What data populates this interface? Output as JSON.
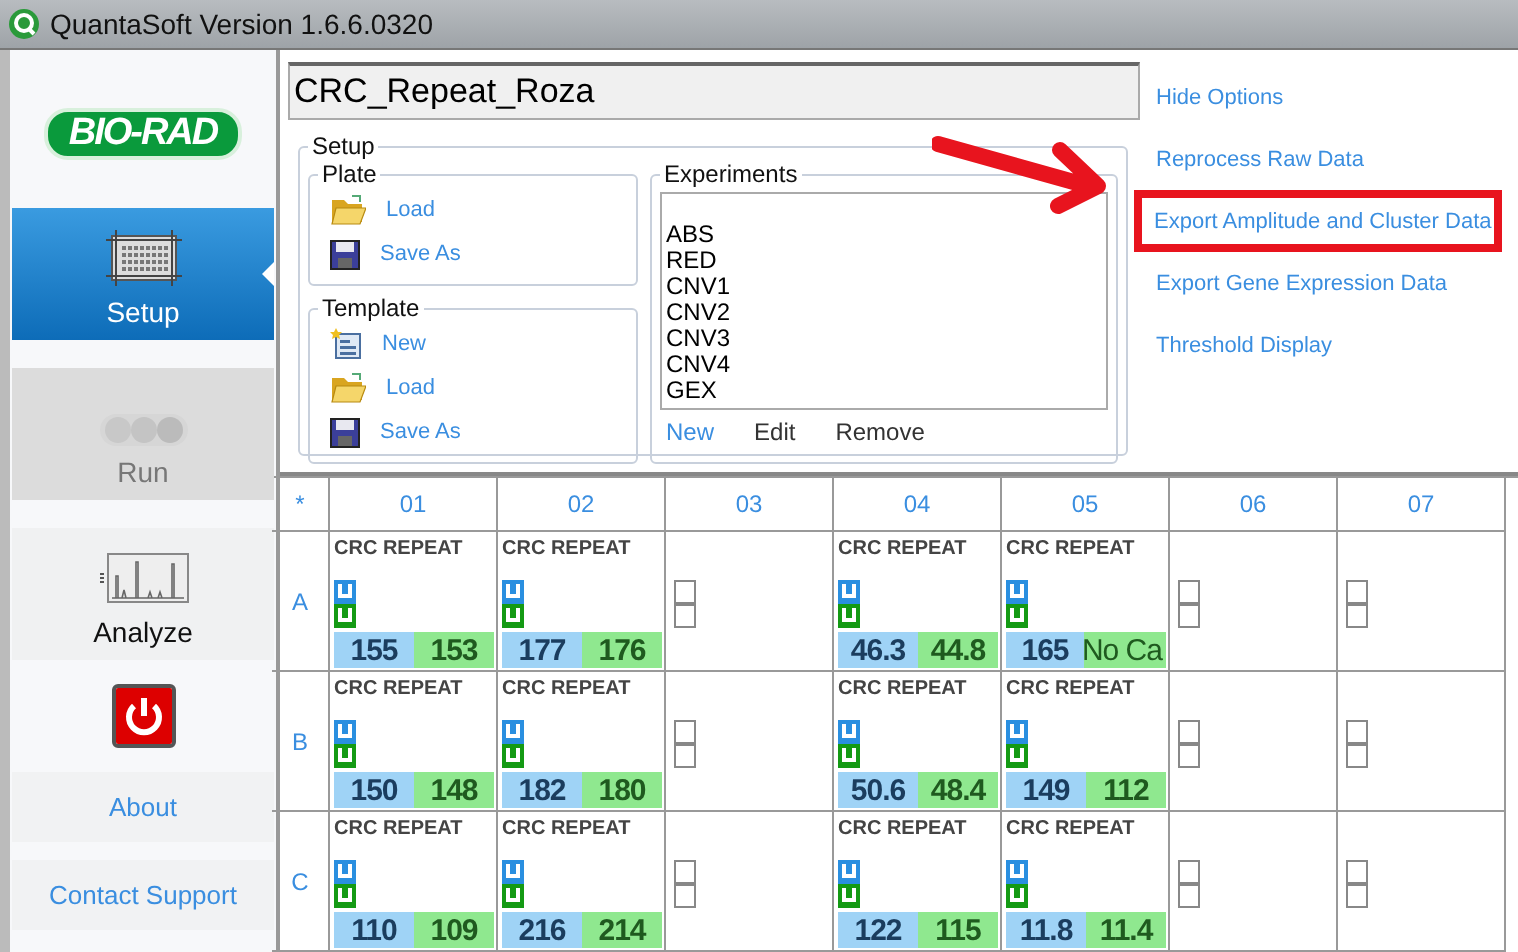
{
  "window": {
    "title": "QuantaSoft Version 1.6.6.0320"
  },
  "sidebar": {
    "logo": "BIO-RAD",
    "nav": [
      {
        "label": "Setup",
        "selected": true,
        "disabled": false
      },
      {
        "label": "Run",
        "selected": false,
        "disabled": true
      },
      {
        "label": "Analyze",
        "selected": false,
        "disabled": false
      }
    ],
    "links": [
      "About",
      "Contact Support"
    ]
  },
  "plate_name": "CRC_Repeat_Roza",
  "setup": {
    "title": "Setup",
    "groups": [
      {
        "title": "Plate",
        "actions": [
          {
            "kind": "load",
            "label": "Load"
          },
          {
            "kind": "save",
            "label": "Save As"
          }
        ]
      },
      {
        "title": "Template",
        "actions": [
          {
            "kind": "new",
            "label": "New"
          },
          {
            "kind": "load",
            "label": "Load"
          },
          {
            "kind": "save",
            "label": "Save As"
          }
        ]
      }
    ],
    "experiments": {
      "title": "Experiments",
      "items": [
        "ABS",
        "RED",
        "CNV1",
        "CNV2",
        "CNV3",
        "CNV4",
        "GEX"
      ],
      "actions": [
        {
          "label": "New",
          "disabled": false
        },
        {
          "label": "Edit",
          "disabled": true
        },
        {
          "label": "Remove",
          "disabled": true
        }
      ]
    }
  },
  "options": [
    {
      "label": "Hide Options",
      "highlighted": false
    },
    {
      "label": "Reprocess Raw Data",
      "highlighted": false
    },
    {
      "label": "Export Amplitude and Cluster Data",
      "highlighted": true
    },
    {
      "label": "Export Gene Expression Data",
      "highlighted": false
    },
    {
      "label": "Threshold Display",
      "highlighted": false
    }
  ],
  "plate": {
    "corner": "*",
    "columns": [
      "01",
      "02",
      "03",
      "04",
      "05",
      "06",
      "07"
    ],
    "rows": [
      {
        "label": "A",
        "wells": [
          {
            "kind": "sample",
            "name": "CRC REPEAT",
            "ch1": "155",
            "ch2": "153"
          },
          {
            "kind": "sample",
            "name": "CRC REPEAT",
            "ch1": "177",
            "ch2": "176"
          },
          {
            "kind": "empty",
            "checks": [
              {
                "checked": false
              },
              {
                "checked": false
              }
            ]
          },
          {
            "kind": "sample",
            "name": "CRC REPEAT",
            "ch1": "46.3",
            "ch2": "44.8"
          },
          {
            "kind": "sample",
            "name": "CRC REPEAT",
            "ch1": "165",
            "ch2": "No Ca"
          },
          {
            "kind": "empty",
            "checks": [
              {
                "checked": false
              },
              {
                "checked": false
              }
            ]
          },
          {
            "kind": "empty",
            "checks": [
              {
                "checked": false
              },
              {
                "checked": false
              }
            ]
          }
        ]
      },
      {
        "label": "B",
        "wells": [
          {
            "kind": "sample",
            "name": "CRC REPEAT",
            "ch1": "150",
            "ch2": "148"
          },
          {
            "kind": "sample",
            "name": "CRC REPEAT",
            "ch1": "182",
            "ch2": "180"
          },
          {
            "kind": "empty",
            "checks": [
              {
                "checked": false
              },
              {
                "checked": false
              }
            ]
          },
          {
            "kind": "sample",
            "name": "CRC REPEAT",
            "ch1": "50.6",
            "ch2": "48.4"
          },
          {
            "kind": "sample",
            "name": "CRC REPEAT",
            "ch1": "149",
            "ch2": "112"
          },
          {
            "kind": "empty",
            "checks": [
              {
                "checked": false
              },
              {
                "checked": false
              }
            ]
          },
          {
            "kind": "empty",
            "checks": [
              {
                "checked": false
              },
              {
                "checked": false
              }
            ]
          }
        ]
      },
      {
        "label": "C",
        "wells": [
          {
            "kind": "sample",
            "name": "CRC REPEAT",
            "ch1": "110",
            "ch2": "109"
          },
          {
            "kind": "sample",
            "name": "CRC REPEAT",
            "ch1": "216",
            "ch2": "214"
          },
          {
            "kind": "empty",
            "checks": [
              {
                "checked": false
              },
              {
                "checked": false
              }
            ]
          },
          {
            "kind": "sample",
            "name": "CRC REPEAT",
            "ch1": "122",
            "ch2": "115"
          },
          {
            "kind": "sample",
            "name": "CRC REPEAT",
            "ch1": "11.8",
            "ch2": "11.4"
          },
          {
            "kind": "empty",
            "checks": [
              {
                "checked": false
              },
              {
                "checked": false
              }
            ]
          },
          {
            "kind": "empty",
            "checks": [
              {
                "checked": false
              },
              {
                "checked": false
              }
            ]
          }
        ]
      }
    ]
  }
}
